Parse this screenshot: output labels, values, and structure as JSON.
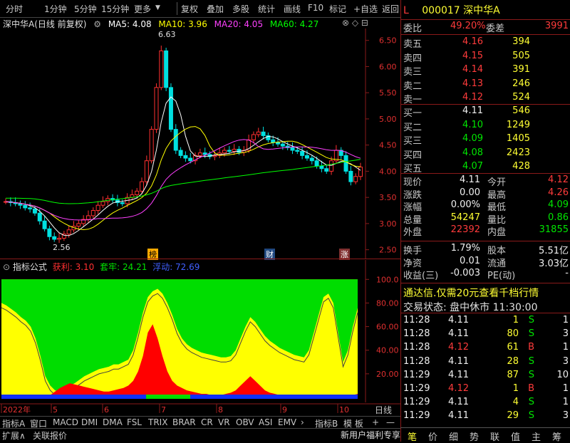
{
  "toolbar": {
    "left": [
      "分时",
      "1分钟",
      "5分钟",
      "15分钟",
      "更多"
    ],
    "right": [
      "复权",
      "叠加",
      "多股",
      "统计",
      "画线",
      "F10",
      "标记",
      "+自选",
      "返回"
    ]
  },
  "legend": {
    "title": "深中华A(日线 前复权)",
    "ma5": "MA5: 4.08",
    "ma10": "MA10: 3.96",
    "ma20": "MA20: 4.05",
    "ma60": "MA60: 4.27"
  },
  "indicator_legend": {
    "name": "指标公式",
    "s1": "获利: 3.10",
    "s2": "套牢: 24.21",
    "s3": "浮动: 72.69"
  },
  "bottom_tabs": [
    "指标A",
    "窗口",
    "MACD",
    "DMI",
    "DMA",
    "FSL",
    "TRIX",
    "BRAR",
    "CR",
    "VR",
    "OBV",
    "ASI",
    "EMV"
  ],
  "bottom_right": [
    "指标B",
    "模 板",
    "+",
    "—"
  ],
  "bottom_row2": [
    "扩展∧",
    "关联报价"
  ],
  "period_label": "日线",
  "ad_text": "新用户福利专享",
  "chart_data": [
    {
      "type": "candlestick",
      "ylim": [
        2.4,
        6.7
      ],
      "yticks": [
        "6.50",
        "6.00",
        "5.50",
        "5.00",
        "4.50",
        "4.00",
        "3.50",
        "3.00",
        "2.50"
      ],
      "xticks": [
        "2022年",
        "5",
        "6",
        "7",
        "8",
        "9",
        "10"
      ],
      "annotations": {
        "high": "6.63",
        "low": "2.56"
      },
      "markers": [
        "榜",
        "财",
        "涨"
      ],
      "ma_colors": {
        "ma5": "#ffffff",
        "ma10": "#ffff00",
        "ma20": "#ff40ff",
        "ma60": "#00ff00"
      },
      "close": [
        3.42,
        3.4,
        3.38,
        3.35,
        3.3,
        3.28,
        3.2,
        3.05,
        2.9,
        2.75,
        2.7,
        2.72,
        2.8,
        2.88,
        2.95,
        3.0,
        3.08,
        3.15,
        3.25,
        3.35,
        3.42,
        3.48,
        3.45,
        3.4,
        3.38,
        3.5,
        3.55,
        3.62,
        3.8,
        4.2,
        4.8,
        5.6,
        6.3,
        5.6,
        4.8,
        4.4,
        4.3,
        4.25,
        4.2,
        4.3,
        4.35,
        4.32,
        4.28,
        4.3,
        4.35,
        4.4,
        4.38,
        4.42,
        4.36,
        4.4,
        4.6,
        4.7,
        4.75,
        4.68,
        4.6,
        4.55,
        4.52,
        4.48,
        4.45,
        4.4,
        4.38,
        4.3,
        4.25,
        4.2,
        4.1,
        4.05,
        4.0,
        4.2,
        4.4,
        4.3,
        4.0,
        3.8,
        3.9,
        4.08
      ]
    },
    {
      "type": "area",
      "ylim": [
        0,
        105
      ],
      "yticks": [
        "100.0",
        "80.00",
        "60.00",
        "40.00",
        "20.00"
      ],
      "series_colors": {
        "s1": "#ff0000",
        "s2": "#00dd00",
        "s3": "#3040ff"
      },
      "profit": [
        0,
        0,
        0,
        0,
        0,
        0,
        0,
        0,
        0,
        0,
        2,
        5,
        8,
        10,
        12,
        11,
        10,
        9,
        8,
        7,
        6,
        5,
        5,
        6,
        7,
        8,
        10,
        14,
        22,
        35,
        55,
        62,
        50,
        35,
        22,
        14,
        10,
        8,
        6,
        5,
        4,
        3,
        3,
        2,
        2,
        2,
        3,
        4,
        6,
        10,
        14,
        18,
        14,
        10,
        6,
        4,
        3,
        2,
        2,
        2,
        1,
        1,
        1,
        1,
        1,
        1,
        1,
        2,
        2,
        1,
        1,
        1,
        2,
        3
      ],
      "trapped": [
        20,
        22,
        25,
        28,
        32,
        35,
        40,
        50,
        65,
        82,
        90,
        94,
        95,
        93,
        90,
        88,
        85,
        82,
        80,
        78,
        76,
        75,
        74,
        72,
        72,
        70,
        68,
        60,
        45,
        28,
        15,
        10,
        8,
        12,
        20,
        30,
        42,
        50,
        55,
        58,
        60,
        62,
        63,
        64,
        65,
        66,
        66,
        65,
        60,
        50,
        40,
        32,
        36,
        42,
        48,
        52,
        55,
        58,
        60,
        62,
        64,
        65,
        66,
        60,
        45,
        30,
        15,
        12,
        20,
        45,
        70,
        60,
        40,
        24
      ]
    }
  ],
  "quote": {
    "code": "000017",
    "name": "深中华A",
    "weibi_label": "委比",
    "weibi": "49.20%",
    "weicha_label": "委差",
    "weicha": "3991",
    "asks": [
      {
        "label": "卖五",
        "price": "4.16",
        "vol": "394"
      },
      {
        "label": "卖四",
        "price": "4.15",
        "vol": "505"
      },
      {
        "label": "卖三",
        "price": "4.14",
        "vol": "391"
      },
      {
        "label": "卖二",
        "price": "4.13",
        "vol": "246"
      },
      {
        "label": "卖一",
        "price": "4.12",
        "vol": "524"
      }
    ],
    "bids": [
      {
        "label": "买一",
        "price": "4.11",
        "vol": "546"
      },
      {
        "label": "买二",
        "price": "4.10",
        "vol": "1249"
      },
      {
        "label": "买三",
        "price": "4.09",
        "vol": "1405"
      },
      {
        "label": "买四",
        "price": "4.08",
        "vol": "2423"
      },
      {
        "label": "买五",
        "price": "4.07",
        "vol": "428"
      }
    ],
    "stats": [
      {
        "l1": "现价",
        "v1": "4.11",
        "l2": "今开",
        "v2": "4.12"
      },
      {
        "l1": "涨跌",
        "v1": "0.00",
        "l2": "最高",
        "v2": "4.26"
      },
      {
        "l1": "涨幅",
        "v1": "0.00%",
        "l2": "最低",
        "v2": "4.09"
      },
      {
        "l1": "总量",
        "v1": "54247",
        "l2": "量比",
        "v2": "0.86"
      },
      {
        "l1": "外盘",
        "v1": "22392",
        "l2": "内盘",
        "v2": "31855"
      }
    ],
    "stats2": [
      {
        "l1": "换手",
        "v1": "1.79%",
        "l2": "股本",
        "v2": "5.51亿"
      },
      {
        "l1": "净资",
        "v1": "0.01",
        "l2": "流通",
        "v2": "3.03亿"
      },
      {
        "l1": "收益(三)",
        "v1": "-0.003",
        "l2": "PE(动)",
        "v2": "-"
      }
    ],
    "banner": "通达信.仅需20元查看千档行情",
    "status": "交易状态: 盘中休市  11:30:00",
    "ticks": [
      {
        "t": "11:28",
        "p": "4.11",
        "v": "1",
        "d": "S",
        "n": "1"
      },
      {
        "t": "11:28",
        "p": "4.11",
        "v": "80",
        "d": "S",
        "n": "3"
      },
      {
        "t": "11:28",
        "p": "4.12",
        "v": "61",
        "d": "B",
        "n": "1"
      },
      {
        "t": "11:28",
        "p": "4.11",
        "v": "28",
        "d": "S",
        "n": "3"
      },
      {
        "t": "11:29",
        "p": "4.11",
        "v": "87",
        "d": "S",
        "n": "10"
      },
      {
        "t": "11:29",
        "p": "4.12",
        "v": "1",
        "d": "B",
        "n": "1"
      },
      {
        "t": "11:29",
        "p": "4.11",
        "v": "4",
        "d": "S",
        "n": "1"
      },
      {
        "t": "11:29",
        "p": "4.11",
        "v": "29",
        "d": "S",
        "n": "3"
      }
    ],
    "tabs": [
      "笔",
      "价",
      "细",
      "势",
      "联",
      "值",
      "主",
      "筹"
    ]
  }
}
